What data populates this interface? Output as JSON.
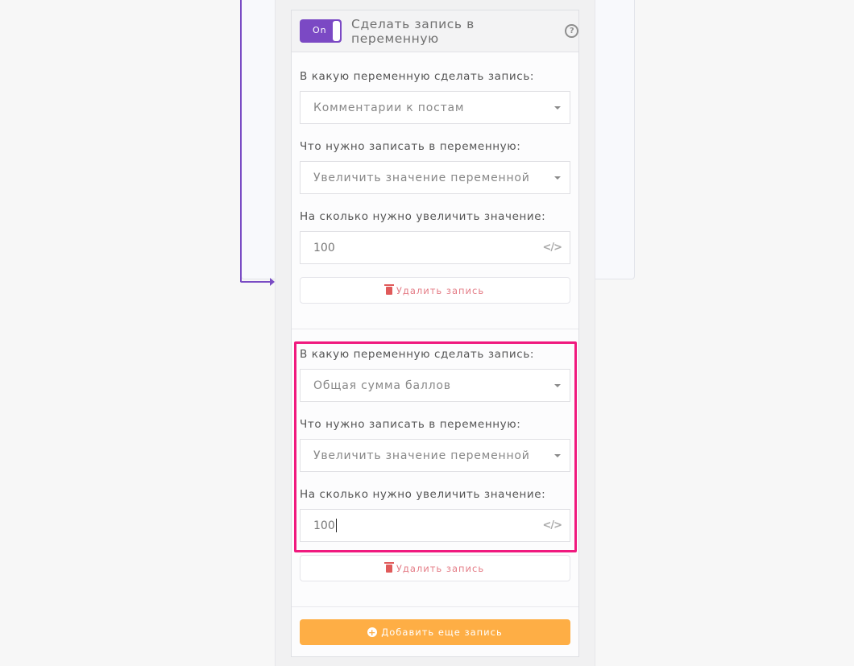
{
  "header": {
    "toggle_label": "On",
    "toggle_state": "on",
    "title": "Сделать запись в переменную",
    "help_icon": "question-circle-icon"
  },
  "records": [
    {
      "variable_label": "В какую переменную сделать запись:",
      "variable_value": "Комментарии к постам",
      "action_label": "Что нужно записать в переменную:",
      "action_value": "Увеличить значение переменной",
      "amount_label": "На сколько нужно увеличить значение:",
      "amount_value": "100",
      "delete_label": "Удалить запись"
    },
    {
      "variable_label": "В какую переменную сделать запись:",
      "variable_value": "Общая сумма баллов",
      "action_label": "Что нужно записать в переменную:",
      "action_value": "Увеличить значение переменной",
      "amount_label": "На сколько нужно увеличить значение:",
      "amount_value": "100",
      "delete_label": "Удалить запись",
      "highlighted": true
    }
  ],
  "add_button_label": "Добавить еще запись",
  "colors": {
    "accent_purple": "#7b49c4",
    "highlight_pink": "#f0197e",
    "add_button_orange": "#feae45",
    "delete_red": "#e05a5a"
  }
}
